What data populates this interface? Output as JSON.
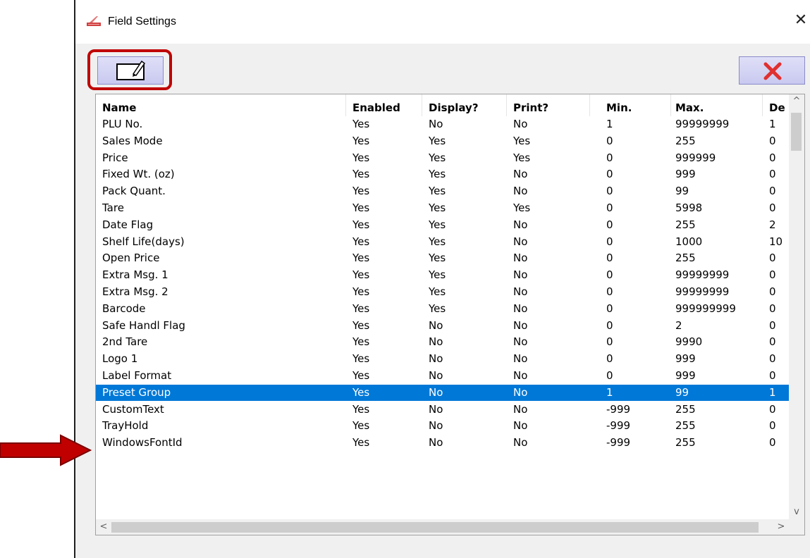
{
  "window": {
    "title": "Field Settings",
    "close_glyph": "✕"
  },
  "toolbar": {
    "edit_icon": "edit-pencil-icon",
    "delete_icon": "red-x-icon",
    "accent": "#c00000"
  },
  "table": {
    "columns": [
      "Name",
      "Enabled",
      "Display?",
      "Print?",
      "Min.",
      "Max.",
      "De"
    ],
    "rows": [
      [
        "PLU No.",
        "Yes",
        "No",
        "No",
        "1",
        "99999999",
        "1"
      ],
      [
        "Sales Mode",
        "Yes",
        "Yes",
        "Yes",
        "0",
        "255",
        "0"
      ],
      [
        "Price",
        "Yes",
        "Yes",
        "Yes",
        "0",
        "999999",
        "0"
      ],
      [
        "Fixed Wt. (oz)",
        "Yes",
        "Yes",
        "No",
        "0",
        "999",
        "0"
      ],
      [
        "Pack Quant.",
        "Yes",
        "Yes",
        "No",
        "0",
        "99",
        "0"
      ],
      [
        "Tare",
        "Yes",
        "Yes",
        "Yes",
        "0",
        "5998",
        "0"
      ],
      [
        "Date Flag",
        "Yes",
        "Yes",
        "No",
        "0",
        "255",
        "2"
      ],
      [
        "Shelf Life(days)",
        "Yes",
        "Yes",
        "No",
        "0",
        "1000",
        "10"
      ],
      [
        "Open Price",
        "Yes",
        "Yes",
        "No",
        "0",
        "255",
        "0"
      ],
      [
        "Extra Msg. 1",
        "Yes",
        "Yes",
        "No",
        "0",
        "99999999",
        "0"
      ],
      [
        "Extra Msg. 2",
        "Yes",
        "Yes",
        "No",
        "0",
        "99999999",
        "0"
      ],
      [
        "Barcode",
        "Yes",
        "Yes",
        "No",
        "0",
        "999999999",
        "0"
      ],
      [
        "Safe Handl Flag",
        "Yes",
        "No",
        "No",
        "0",
        "2",
        "0"
      ],
      [
        "2nd Tare",
        "Yes",
        "No",
        "No",
        "0",
        "9990",
        "0"
      ],
      [
        "Logo 1",
        "Yes",
        "No",
        "No",
        "0",
        "999",
        "0"
      ],
      [
        "Label Format",
        "Yes",
        "No",
        "No",
        "0",
        "999",
        "0"
      ],
      [
        "Preset Group",
        "Yes",
        "No",
        "No",
        "1",
        "99",
        "1"
      ],
      [
        "CustomText",
        "Yes",
        "No",
        "No",
        "-999",
        "255",
        "0"
      ],
      [
        "TrayHold",
        "Yes",
        "No",
        "No",
        "-999",
        "255",
        "0"
      ],
      [
        "WindowsFontId",
        "Yes",
        "No",
        "No",
        "-999",
        "255",
        "0"
      ]
    ],
    "selected_row": 16,
    "selection_color": "#0078d7"
  },
  "scrollbars": {
    "up": "^",
    "down": "v",
    "left": "<",
    "right": ">"
  }
}
